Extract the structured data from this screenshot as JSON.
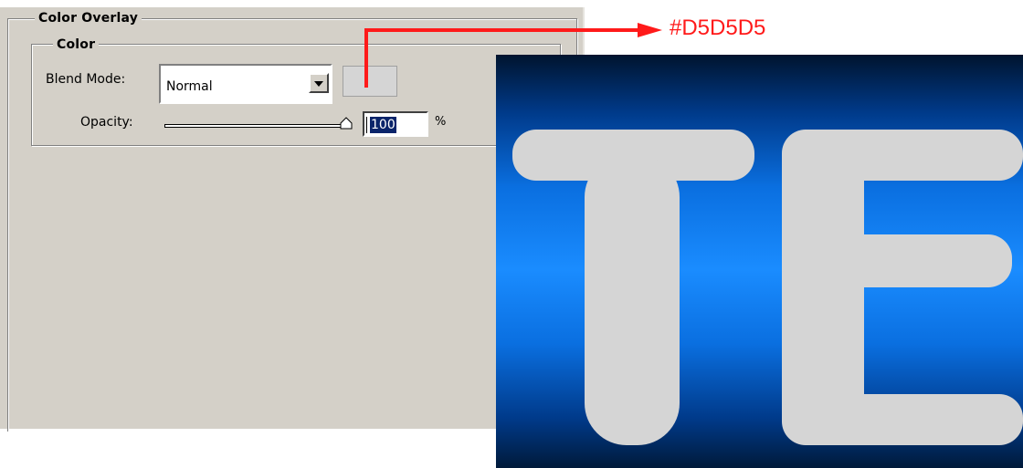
{
  "panel": {
    "section_title": "Color Overlay",
    "group_title": "Color",
    "blend_mode_label": "Blend Mode:",
    "blend_mode_value": "Normal",
    "opacity_label": "Opacity:",
    "opacity_value": "100",
    "opacity_unit": "%",
    "opacity_fraction": 1.0,
    "overlay_color": "#D5D5D5"
  },
  "annotation": {
    "label": "#D5D5D5",
    "color": "#ff1a1a"
  },
  "preview": {
    "text": "TE",
    "letter_color": "#d5d5d5",
    "gradient_colors": [
      "#00142e",
      "#1a8cff",
      "#001a3a"
    ]
  }
}
